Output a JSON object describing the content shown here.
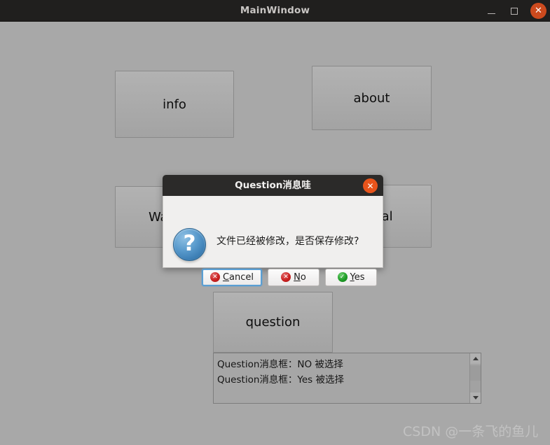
{
  "window": {
    "title": "MainWindow",
    "controls": {
      "minimize": "−",
      "maximize": "□",
      "close": "✕"
    }
  },
  "main": {
    "buttons": [
      {
        "name": "info-button",
        "label": "info"
      },
      {
        "name": "about-button",
        "label": "about"
      },
      {
        "name": "warning-button",
        "label": "Warning"
      },
      {
        "name": "critical-button",
        "label": "critical"
      },
      {
        "name": "question-button",
        "label": "question"
      }
    ],
    "log": {
      "items": [
        "Question消息框：NO 被选择",
        "Question消息框：Yes 被选择"
      ],
      "scroll_up": "▲",
      "scroll_down": "▼"
    }
  },
  "dialog": {
    "title": "Question消息哇",
    "close_glyph": "✕",
    "icon": "question-mark-icon",
    "icon_glyph": "?",
    "message": "文件已经被修改，是否保存修改?",
    "buttons": [
      {
        "name": "cancel-button",
        "badge": "error-badge",
        "badge_glyph": "✕",
        "badge_color": "#cc2222",
        "prefix": "",
        "accel": "C",
        "suffix": "ancel",
        "focused": true
      },
      {
        "name": "no-button",
        "badge": "error-badge",
        "badge_glyph": "✕",
        "badge_color": "#cc2222",
        "prefix": "",
        "accel": "N",
        "suffix": "o",
        "focused": false
      },
      {
        "name": "yes-button",
        "badge": "ok-badge",
        "badge_glyph": "✓",
        "badge_color": "#1f9e28",
        "prefix": "",
        "accel": "Y",
        "suffix": "es",
        "focused": false
      }
    ]
  },
  "watermark": "CSDN @一条飞的鱼儿"
}
